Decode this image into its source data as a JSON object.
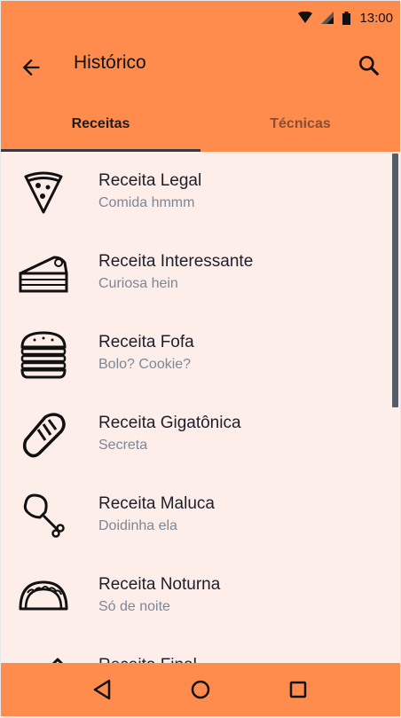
{
  "status_bar": {
    "time": "13:00",
    "icons": [
      "wifi-icon",
      "signal-icon",
      "battery-icon"
    ]
  },
  "app_bar": {
    "title": "Histórico",
    "back_icon": "arrow-left-icon",
    "search_icon": "search-icon"
  },
  "tabs": [
    {
      "label": "Receitas",
      "active": true
    },
    {
      "label": "Técnicas",
      "active": false
    }
  ],
  "recipes": [
    {
      "title": "Receita Legal",
      "subtitle": "Comida hmmm",
      "icon": "pizza-icon"
    },
    {
      "title": "Receita Interessante",
      "subtitle": "Curiosa hein",
      "icon": "cake-icon"
    },
    {
      "title": "Receita Fofa",
      "subtitle": "Bolo? Cookie?",
      "icon": "burger-icon"
    },
    {
      "title": "Receita Gigatônica",
      "subtitle": "Secreta",
      "icon": "bread-icon"
    },
    {
      "title": "Receita Maluca",
      "subtitle": "Doidinha ela",
      "icon": "chicken-leg-icon"
    },
    {
      "title": "Receita Noturna",
      "subtitle": "Só de noite",
      "icon": "taco-icon"
    },
    {
      "title": "Receita Final",
      "subtitle": "",
      "icon": "bottle-icon"
    }
  ],
  "nav_bar": {
    "buttons": [
      "back-triangle-icon",
      "home-circle-icon",
      "recents-square-icon"
    ]
  },
  "colors": {
    "accent": "#ff8c4c",
    "background": "#fdeeea",
    "title_text": "#1c1f2b",
    "subtitle_text": "#7c8797"
  }
}
